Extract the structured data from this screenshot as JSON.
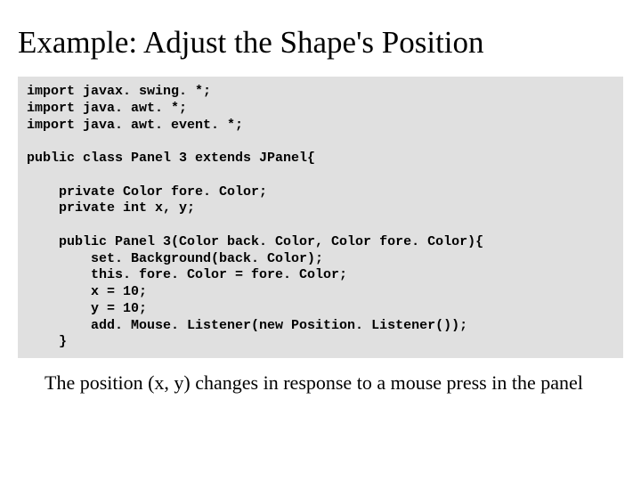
{
  "title": "Example: Adjust the Shape's Position",
  "code": {
    "l1": "import javax. swing. *;",
    "l2": "import java. awt. *;",
    "l3": "import java. awt. event. *;",
    "l4": "",
    "l5": "public class Panel 3 extends JPanel{",
    "l6": "",
    "l7": "    private Color fore. Color;",
    "l8": "    private int x, y;",
    "l9": "",
    "l10": "    public Panel 3(Color back. Color, Color fore. Color){",
    "l11": "        set. Background(back. Color);",
    "l12": "        this. fore. Color = fore. Color;",
    "l13": "        x = 10;",
    "l14": "        y = 10;",
    "l15": "        add. Mouse. Listener(new Position. Listener());",
    "l16": "    }"
  },
  "caption": "The position (x, y) changes in response to a mouse press in the panel"
}
